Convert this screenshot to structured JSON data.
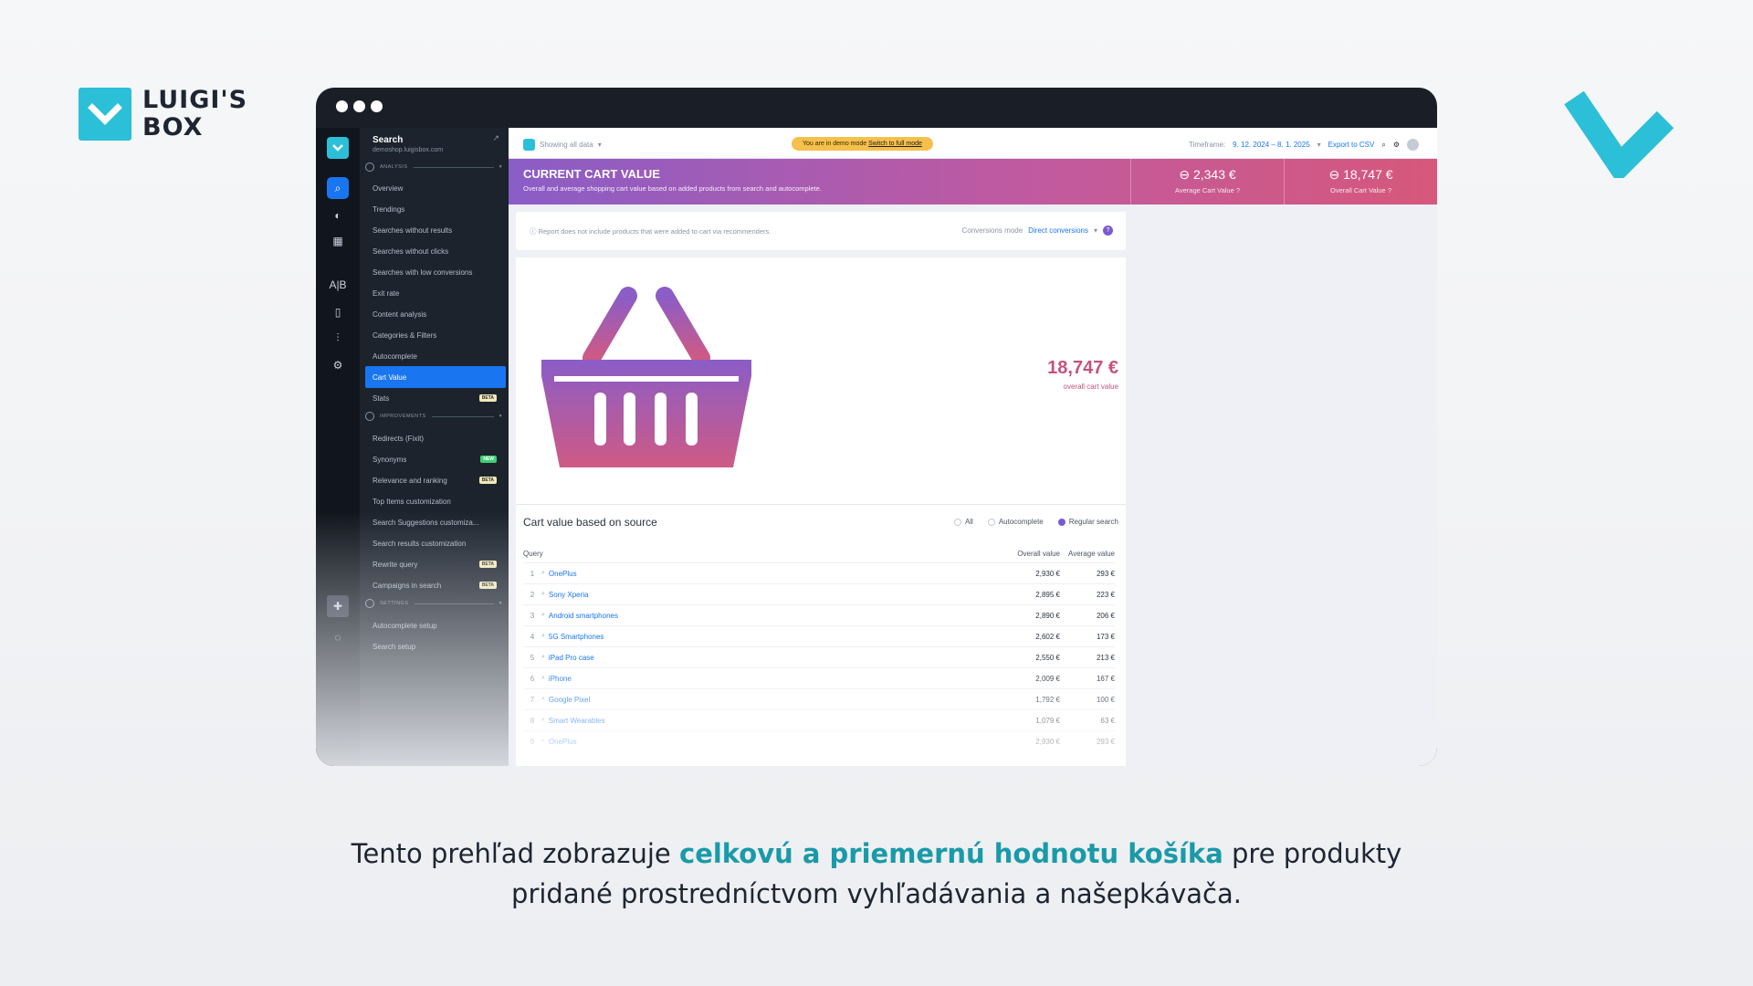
{
  "brand": {
    "line1": "LUIGI'S",
    "line2": "BOX",
    "color": "#2cbfd8"
  },
  "nav": {
    "title": "Search",
    "subtitle": "demoshop.luigisbox.com",
    "sections": {
      "analysis": "ANALYSIS",
      "improvements": "IMPROVEMENTS",
      "settings": "SETTINGS"
    },
    "items": [
      "Overview",
      "Trendings",
      "Searches without results",
      "Searches without clicks",
      "Searches with low conversions",
      "Exit rate",
      "Content analysis",
      "Categories & Filters",
      "Autocomplete",
      "Cart Value",
      "Stats"
    ],
    "improvements": [
      "Redirects (Fixit)",
      "Synonyms",
      "Relevance and ranking",
      "Top Items customization",
      "Search Suggestions customiza...",
      "Search results customization",
      "Rewrite query",
      "Campaigns in search"
    ],
    "settings_items": [
      "Autocomplete setup",
      "Search setup"
    ],
    "badges": {
      "beta": "BETA",
      "new": "NEW"
    }
  },
  "topbar": {
    "showing": "Showing all data",
    "demo_text": "You are in demo mode",
    "demo_link": "Switch to full mode",
    "timeframe_label": "Timeframe:",
    "timeframe_value": "9. 12. 2024 – 8. 1. 2025",
    "export": "Export to CSV"
  },
  "banner": {
    "title": "CURRENT CART VALUE",
    "desc": "Overall and average shopping cart value based on added products from search and autocomplete.",
    "avg_value": "2,343 €",
    "avg_label": "Average Cart Value",
    "overall_value": "18,747 €",
    "overall_label": "Overall Cart Value"
  },
  "note": {
    "text": "Report does not include products that were added to cart via recommenders.",
    "mode_label": "Conversions mode",
    "mode_value": "Direct conversions"
  },
  "hero": {
    "value": "18,747 €",
    "label": "overall cart value"
  },
  "table": {
    "title": "Cart value based on source",
    "radios": [
      "All",
      "Autocomplete",
      "Regular search"
    ],
    "headers": {
      "query": "Query",
      "overall": "Overall value",
      "average": "Average value"
    },
    "rows": [
      {
        "n": "1",
        "q": "OnePlus",
        "o": "2,930 €",
        "a": "293 €"
      },
      {
        "n": "2",
        "q": "Sony Xperia",
        "o": "2,895 €",
        "a": "223 €"
      },
      {
        "n": "3",
        "q": "Android smartphones",
        "o": "2,890 €",
        "a": "206 €"
      },
      {
        "n": "4",
        "q": "5G Smartphones",
        "o": "2,602 €",
        "a": "173 €"
      },
      {
        "n": "5",
        "q": "iPad Pro case",
        "o": "2,550 €",
        "a": "213 €"
      },
      {
        "n": "6",
        "q": "iPhone",
        "o": "2,009 €",
        "a": "167 €"
      },
      {
        "n": "7",
        "q": "Google Pixel",
        "o": "1,792 €",
        "a": "100 €"
      },
      {
        "n": "8",
        "q": "Smart Wearables",
        "o": "1,079 €",
        "a": "63 €"
      },
      {
        "n": "9",
        "q": "OnePlus",
        "o": "2,930 €",
        "a": "293 €"
      }
    ]
  },
  "caption": {
    "pre": "Tento prehľad zobrazuje ",
    "highlight": "celkovú a priemernú hodnotu košíka",
    "post1": " pre produkty",
    "line2": "pridané prostredníctvom vyhľadávania a našepkávača."
  }
}
